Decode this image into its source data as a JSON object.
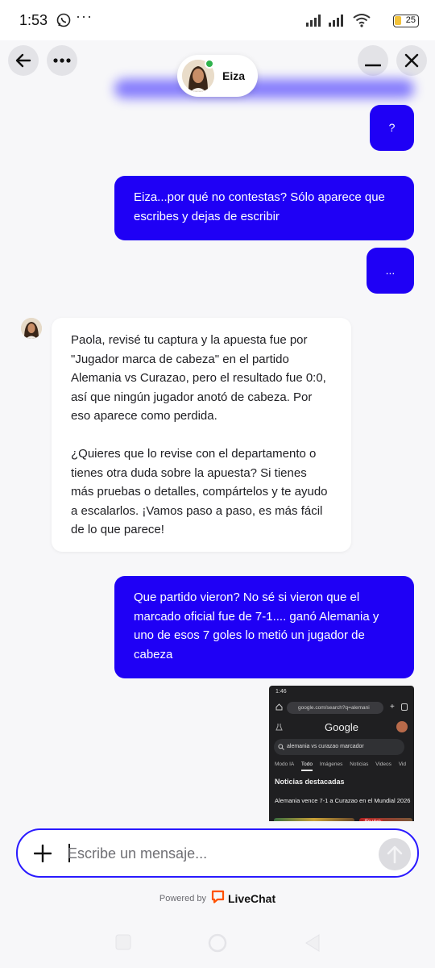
{
  "status_bar": {
    "time": "1:53",
    "more": "···",
    "battery": "25",
    "battery_color": "#f2c23a"
  },
  "header": {
    "back_icon": "arrow-left-icon",
    "more_icon": "more-horizontal-icon",
    "minimize_icon": "minimize-icon",
    "close_icon": "close-icon"
  },
  "agent": {
    "name": "Eiza",
    "status_color": "#2fb24c"
  },
  "theme": {
    "accent": "#1f00f5",
    "background": "#f7f7f9"
  },
  "messages": [
    {
      "from": "visitor",
      "text": "?"
    },
    {
      "from": "visitor",
      "text": "Eiza...por qué no contestas? Sólo aparece que escribes y dejas de escribir"
    },
    {
      "from": "visitor",
      "text": "..."
    },
    {
      "from": "agent",
      "paragraphs": [
        "Paola, revisé tu captura y la apuesta fue por \"Jugador marca de cabeza\" en el partido Alemania vs Curazao, pero el resultado fue 0:0, así que ningún jugador anotó de cabeza. Por eso aparece como perdida.",
        "¿Quieres que lo revise con el departamento o tienes otra duda sobre la apuesta? Si tienes más pruebas o detalles, compártelos y te ayudo a escalarlos. ¡Vamos paso a paso, es más fácil de lo que parece!"
      ]
    },
    {
      "from": "visitor",
      "text": "Que partido vieron? No sé si vieron que el marcado oficial fue de 7-1.... ganó Alemania y uno de esos 7 goles lo metió un jugador de cabeza"
    }
  ],
  "attachment": {
    "time": "1:46",
    "url": "google.com/search?q=alemani",
    "logo": "Google",
    "query": "alemania vs curazao marcador",
    "tabs": [
      "Modo IA",
      "Todo",
      "Imágenes",
      "Noticias",
      "Videos",
      "Vid"
    ],
    "section": "Noticias destacadas",
    "headline": "Alemania vence 7-1 a Curazao en el Mundial 2026",
    "live": "En vivo"
  },
  "composer": {
    "placeholder": "Escribe un mensaje...",
    "add_icon": "plus-icon",
    "send_icon": "send-arrow-icon"
  },
  "footer": {
    "powered_by": "Powered by",
    "brand": "LiveChat"
  }
}
